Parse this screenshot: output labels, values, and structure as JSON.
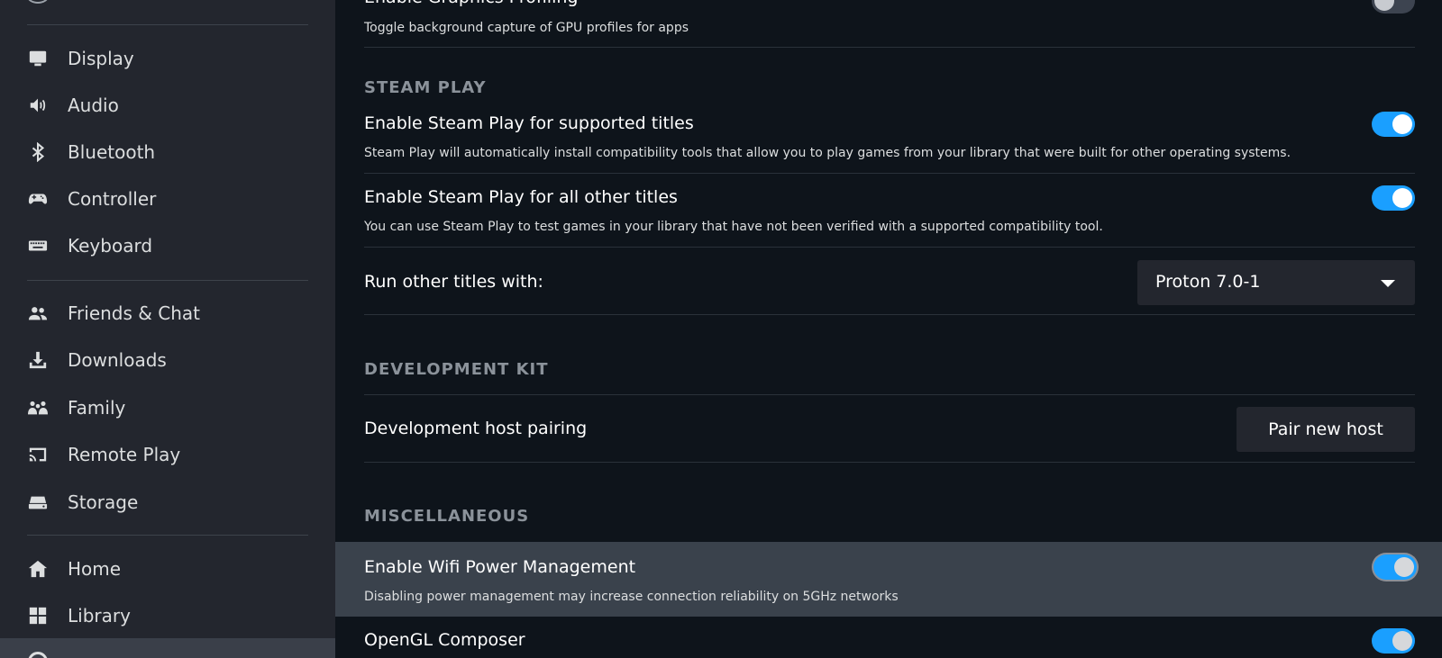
{
  "sidebar": {
    "items": [
      {
        "label": "Display",
        "icon": "monitor-icon"
      },
      {
        "label": "Audio",
        "icon": "speaker-icon"
      },
      {
        "label": "Bluetooth",
        "icon": "bluetooth-icon"
      },
      {
        "label": "Controller",
        "icon": "gamepad-icon"
      },
      {
        "label": "Keyboard",
        "icon": "keyboard-icon"
      },
      {
        "label": "Friends & Chat",
        "icon": "friends-icon"
      },
      {
        "label": "Downloads",
        "icon": "download-icon"
      },
      {
        "label": "Family",
        "icon": "family-icon"
      },
      {
        "label": "Remote Play",
        "icon": "cast-icon"
      },
      {
        "label": "Storage",
        "icon": "storage-icon"
      },
      {
        "label": "Home",
        "icon": "home-icon"
      },
      {
        "label": "Library",
        "icon": "library-grid-icon"
      }
    ]
  },
  "main": {
    "top_partial": {
      "title": "Enable Graphics Profiling",
      "desc": "Toggle background capture of GPU profiles for apps",
      "toggle": "off"
    },
    "steam_play": {
      "header": "STEAM PLAY",
      "supported": {
        "title": "Enable Steam Play for supported titles",
        "desc": "Steam Play will automatically install compatibility tools that allow you to play games from your library that were built for other operating systems.",
        "toggle": "on"
      },
      "all_other": {
        "title": "Enable Steam Play for all other titles",
        "desc": "You can use Steam Play to test games in your library that have not been verified with a supported compatibility tool.",
        "toggle": "on"
      },
      "run_with": {
        "label": "Run other titles with:",
        "selected": "Proton 7.0-1"
      }
    },
    "dev_kit": {
      "header": "DEVELOPMENT KIT",
      "pairing_label": "Development host pairing",
      "pair_button": "Pair new host"
    },
    "misc": {
      "header": "MISCELLANEOUS",
      "wifi": {
        "title": "Enable Wifi Power Management",
        "desc": "Disabling power management may increase connection reliability on 5GHz networks",
        "toggle": "on"
      },
      "opengl": {
        "title": "OpenGL Composer",
        "toggle": "on"
      }
    }
  },
  "colors": {
    "accent": "#1a9fff",
    "sidebar_bg": "#23262e",
    "main_bg": "#0e141b",
    "highlight": "#3a424c"
  }
}
